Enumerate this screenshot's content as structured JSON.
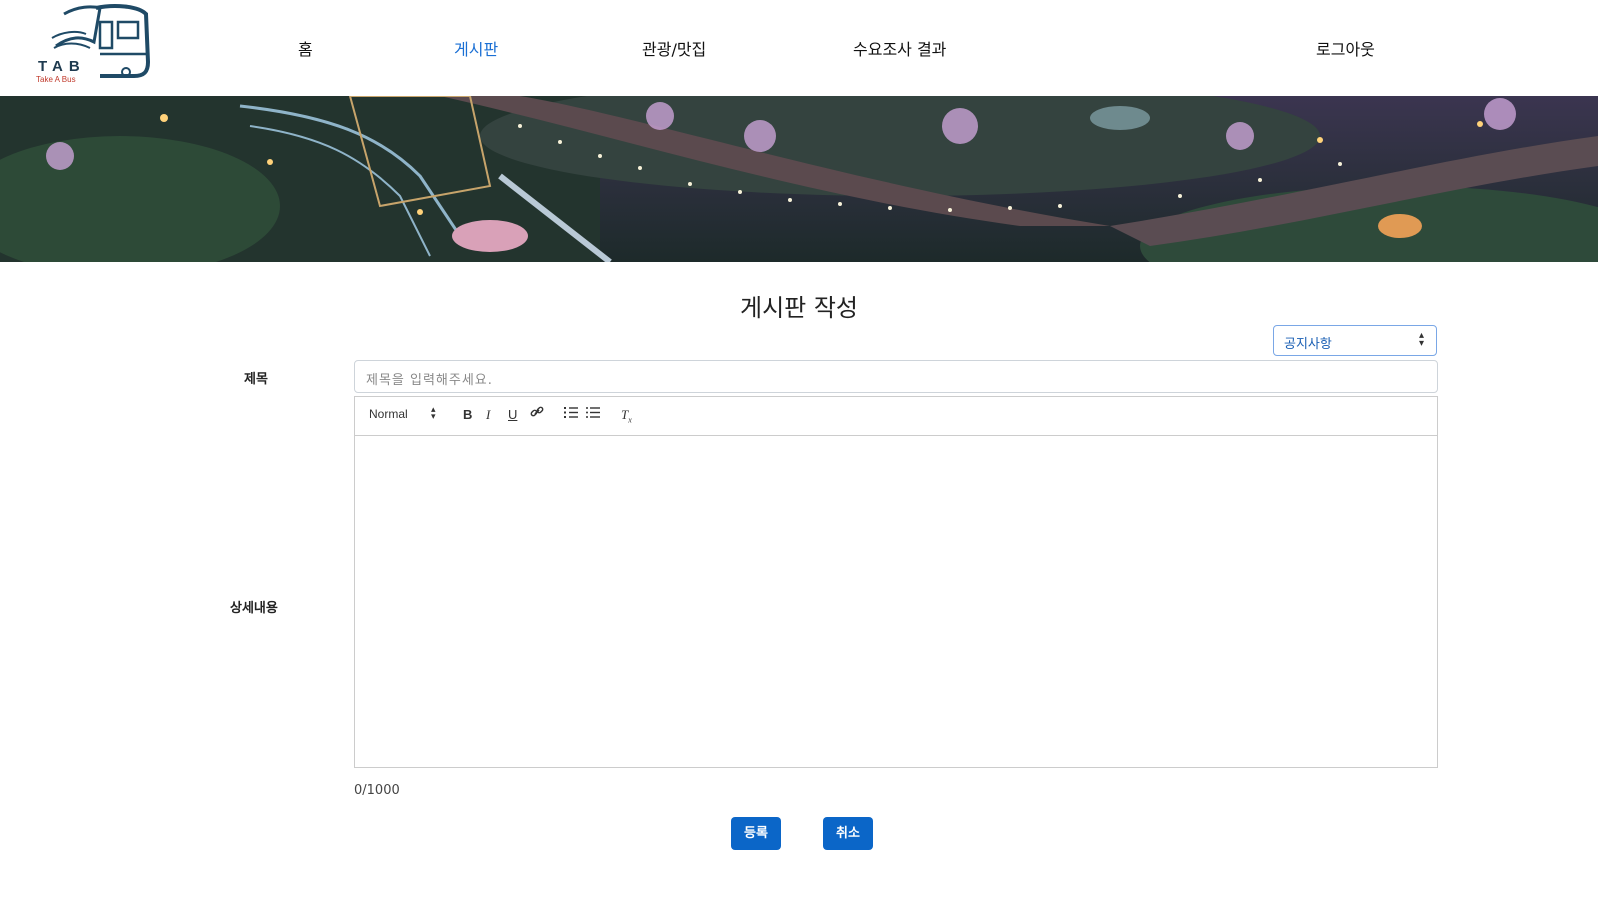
{
  "logo": {
    "title": "TAB",
    "subtitle": "Take A Bus"
  },
  "nav": {
    "items": [
      {
        "label": "홈",
        "active": false
      },
      {
        "label": "게시판",
        "active": true
      },
      {
        "label": "관광/맛집",
        "active": false
      },
      {
        "label": "수요조사 결과",
        "active": false
      }
    ],
    "logout": "로그아웃"
  },
  "page": {
    "title": "게시판 작성"
  },
  "form": {
    "category": "공지사항",
    "title_label": "제목",
    "title_placeholder": "제목을 입력해주세요.",
    "content_label": "상세내용",
    "header_select": "Normal",
    "counter": "0/1000",
    "submit": "등록",
    "cancel": "취소"
  },
  "colors": {
    "accent": "#0b66c8",
    "active_nav": "#1a6fd4"
  }
}
